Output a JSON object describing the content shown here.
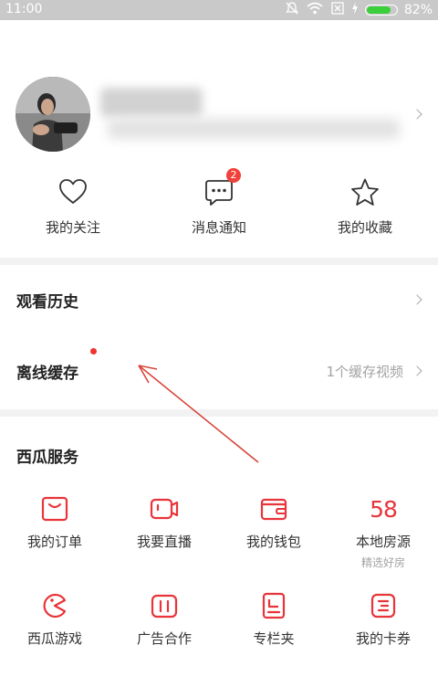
{
  "status_bar": {
    "time": "11:00",
    "battery_percent": "82%",
    "battery_level": 0.82
  },
  "profile": {},
  "quick_actions": [
    {
      "label": "我的关注",
      "icon": "heart-icon"
    },
    {
      "label": "消息通知",
      "icon": "message-icon",
      "badge": "2"
    },
    {
      "label": "我的收藏",
      "icon": "star-icon"
    }
  ],
  "menu": {
    "history": {
      "label": "观看历史"
    },
    "offline": {
      "label": "离线缓存",
      "detail": "1个缓存视频"
    }
  },
  "services": {
    "title": "西瓜服务",
    "items": [
      {
        "label": "我的订单",
        "icon": "order-icon"
      },
      {
        "label": "我要直播",
        "icon": "live-camera-icon"
      },
      {
        "label": "我的钱包",
        "icon": "wallet-icon"
      },
      {
        "label": "本地房源",
        "icon": "58-icon",
        "icon_text": "58",
        "sub": "精选好房"
      },
      {
        "label": "西瓜游戏",
        "icon": "game-icon"
      },
      {
        "label": "广告合作",
        "icon": "ad-icon"
      },
      {
        "label": "专栏夹",
        "icon": "column-icon"
      },
      {
        "label": "我的卡券",
        "icon": "coupon-icon"
      }
    ]
  },
  "colors": {
    "accent": "#e8343a",
    "badge": "#f0413a",
    "separator": "#f2f2f2",
    "status_bar": "#c9c9c9"
  }
}
